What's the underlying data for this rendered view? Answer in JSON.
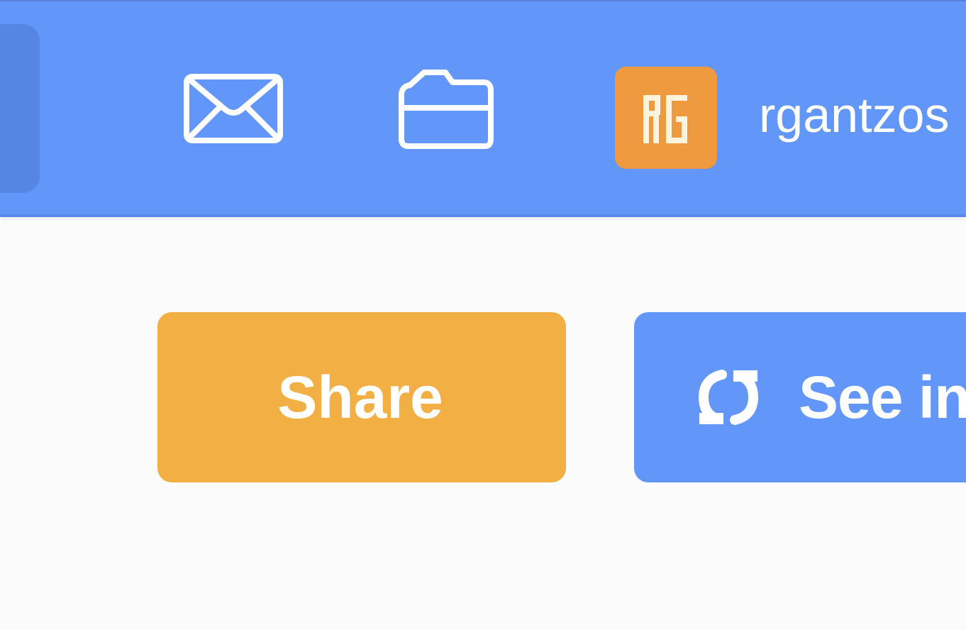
{
  "header": {
    "sidebar_toggle": "sidebar-toggle",
    "icons": {
      "mail": "mail-icon",
      "folder": "folder-icon"
    },
    "user": {
      "avatar_initials": "RG",
      "username": "rgantzos"
    }
  },
  "actions": {
    "share_label": "Share",
    "see_inside_label": "See inside",
    "see_inside_icon": "refresh-icon"
  },
  "colors": {
    "header_blue": "#6296f8",
    "share_orange": "#f2af43",
    "avatar_orange": "#f09a3f",
    "background": "#fbfbfb"
  }
}
